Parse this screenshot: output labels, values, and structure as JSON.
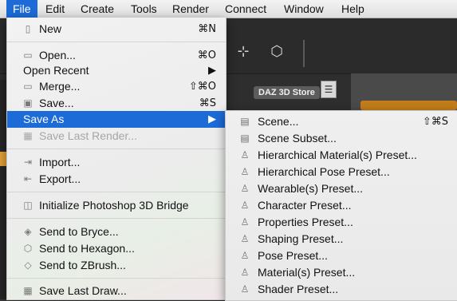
{
  "menubar": {
    "items": [
      "File",
      "Edit",
      "Create",
      "Tools",
      "Render",
      "Connect",
      "Window",
      "Help"
    ],
    "active": "File"
  },
  "app": {
    "store_tab": "DAZ 3D Store",
    "toolbar_icons": [
      "figure-add-icon",
      "prop-add-icon"
    ]
  },
  "file_menu": {
    "items": [
      {
        "label": "New",
        "shortcut": "⌘N",
        "icon": "new-document-icon"
      },
      {
        "label": "Open...",
        "shortcut": "⌘O",
        "icon": "open-folder-icon"
      },
      {
        "label": "Open Recent",
        "shortcut": "▶",
        "icon": ""
      },
      {
        "label": "Merge...",
        "shortcut": "⇧⌘O",
        "icon": "merge-folder-icon"
      },
      {
        "label": "Save...",
        "shortcut": "⌘S",
        "icon": "floppy-disk-icon"
      },
      {
        "label": "Save As",
        "shortcut": "▶",
        "icon": ""
      },
      {
        "label": "Save Last Render...",
        "shortcut": "",
        "icon": "render-image-icon"
      },
      {
        "label": "Import...",
        "shortcut": "",
        "icon": "import-icon"
      },
      {
        "label": "Export...",
        "shortcut": "",
        "icon": "export-icon"
      },
      {
        "label": "Initialize Photoshop 3D Bridge",
        "shortcut": "",
        "icon": "photoshop-bridge-icon"
      },
      {
        "label": "Send to Bryce...",
        "shortcut": "",
        "icon": "bryce-icon"
      },
      {
        "label": "Send to Hexagon...",
        "shortcut": "",
        "icon": "hexagon-icon"
      },
      {
        "label": "Send to ZBrush...",
        "shortcut": "",
        "icon": "zbrush-icon"
      },
      {
        "label": "Save Last Draw...",
        "shortcut": "",
        "icon": "save-draw-icon"
      }
    ]
  },
  "save_as_menu": {
    "items": [
      {
        "label": "Scene...",
        "shortcut": "⇧⌘S",
        "icon": "scene-icon"
      },
      {
        "label": "Scene Subset...",
        "shortcut": "",
        "icon": "scene-subset-icon"
      },
      {
        "label": "Hierarchical Material(s) Preset...",
        "shortcut": "",
        "icon": "hierarchical-material-icon"
      },
      {
        "label": "Hierarchical Pose Preset...",
        "shortcut": "",
        "icon": "hierarchical-pose-icon"
      },
      {
        "label": "Wearable(s) Preset...",
        "shortcut": "",
        "icon": "wearable-icon"
      },
      {
        "label": "Character Preset...",
        "shortcut": "",
        "icon": "character-icon"
      },
      {
        "label": "Properties Preset...",
        "shortcut": "",
        "icon": "properties-icon"
      },
      {
        "label": "Shaping Preset...",
        "shortcut": "",
        "icon": "shaping-icon"
      },
      {
        "label": "Pose Preset...",
        "shortcut": "",
        "icon": "pose-icon"
      },
      {
        "label": "Material(s) Preset...",
        "shortcut": "",
        "icon": "material-icon"
      },
      {
        "label": "Shader Preset...",
        "shortcut": "",
        "icon": "shader-icon"
      }
    ]
  },
  "colors": {
    "highlight": "#1c6bd6",
    "disabled_text": "#a6a6a6",
    "store_accent": "#c27d1a"
  }
}
